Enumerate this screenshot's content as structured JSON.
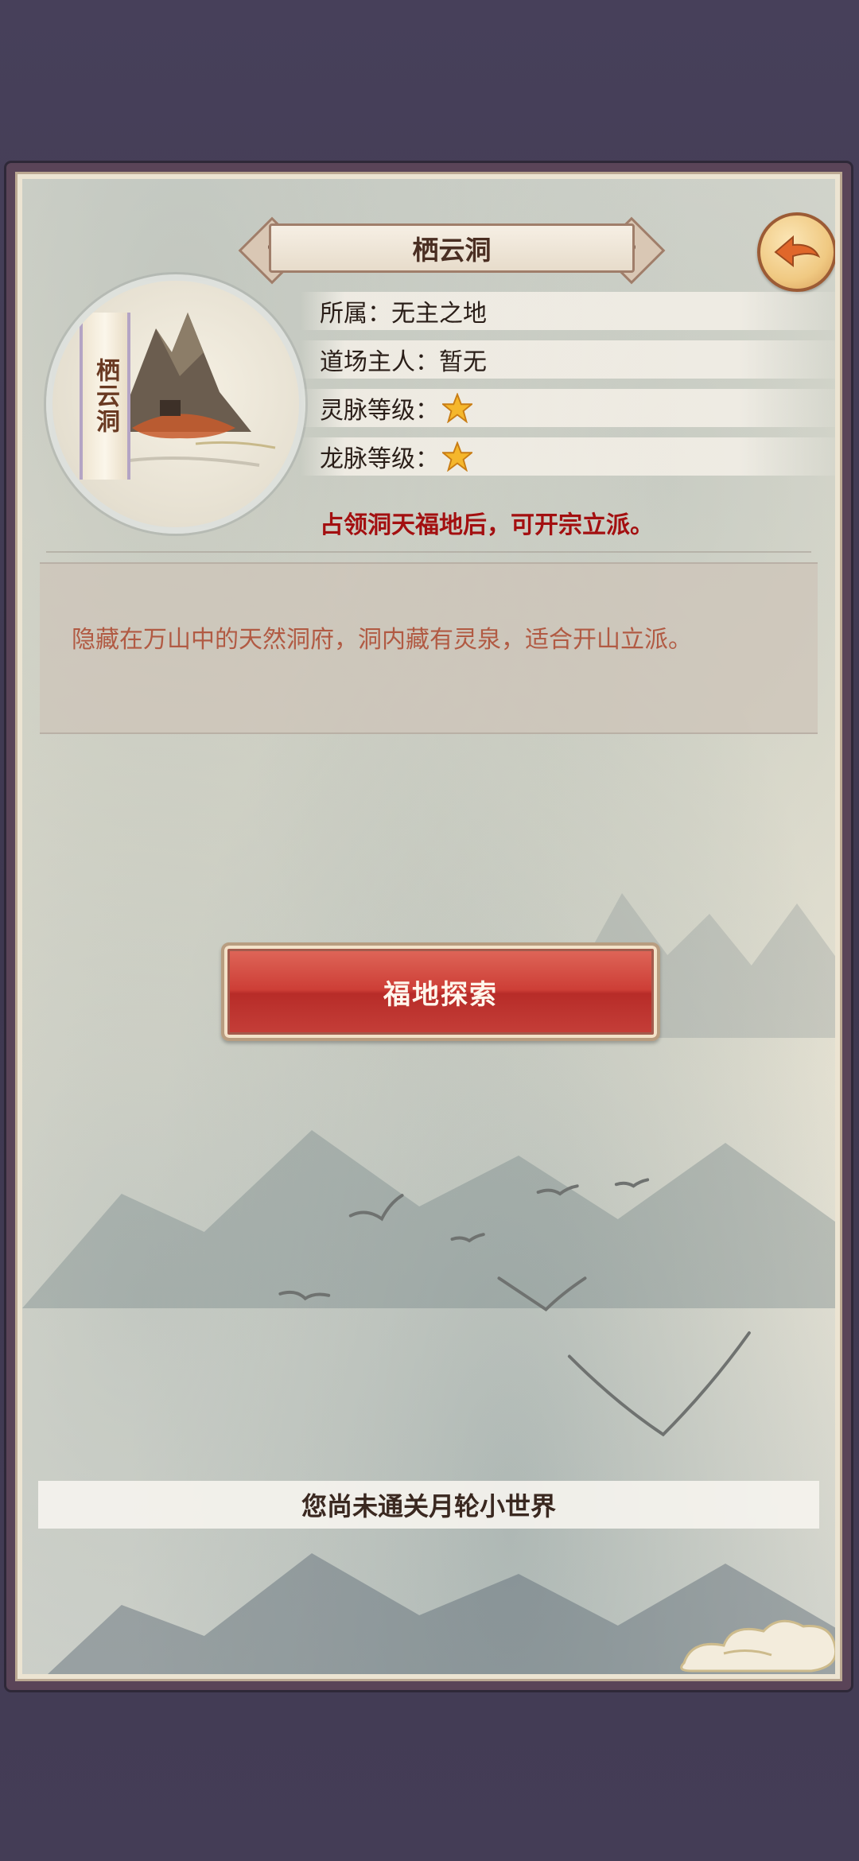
{
  "location": {
    "name": "栖云洞",
    "scroll_label": "栖云洞",
    "info": [
      {
        "label": "所属：",
        "value": "无主之地"
      },
      {
        "label": "道场主人：",
        "value": "暂无"
      },
      {
        "label": "灵脉等级：",
        "stars": 1
      },
      {
        "label": "龙脉等级：",
        "stars": 1
      }
    ],
    "notice": "占领洞天福地后，可开宗立派。",
    "description": "隐藏在万山中的天然洞府，洞内藏有灵泉，适合开山立派。"
  },
  "actions": {
    "explore_label": "福地探索",
    "back_icon": "back-arrow-icon"
  },
  "status": {
    "message": "您尚未通关月轮小世界"
  },
  "colors": {
    "accent_red": "#a30f10",
    "button_red": "#cd3e36",
    "star_gold": "#f5b72c",
    "background": "#443d56"
  }
}
